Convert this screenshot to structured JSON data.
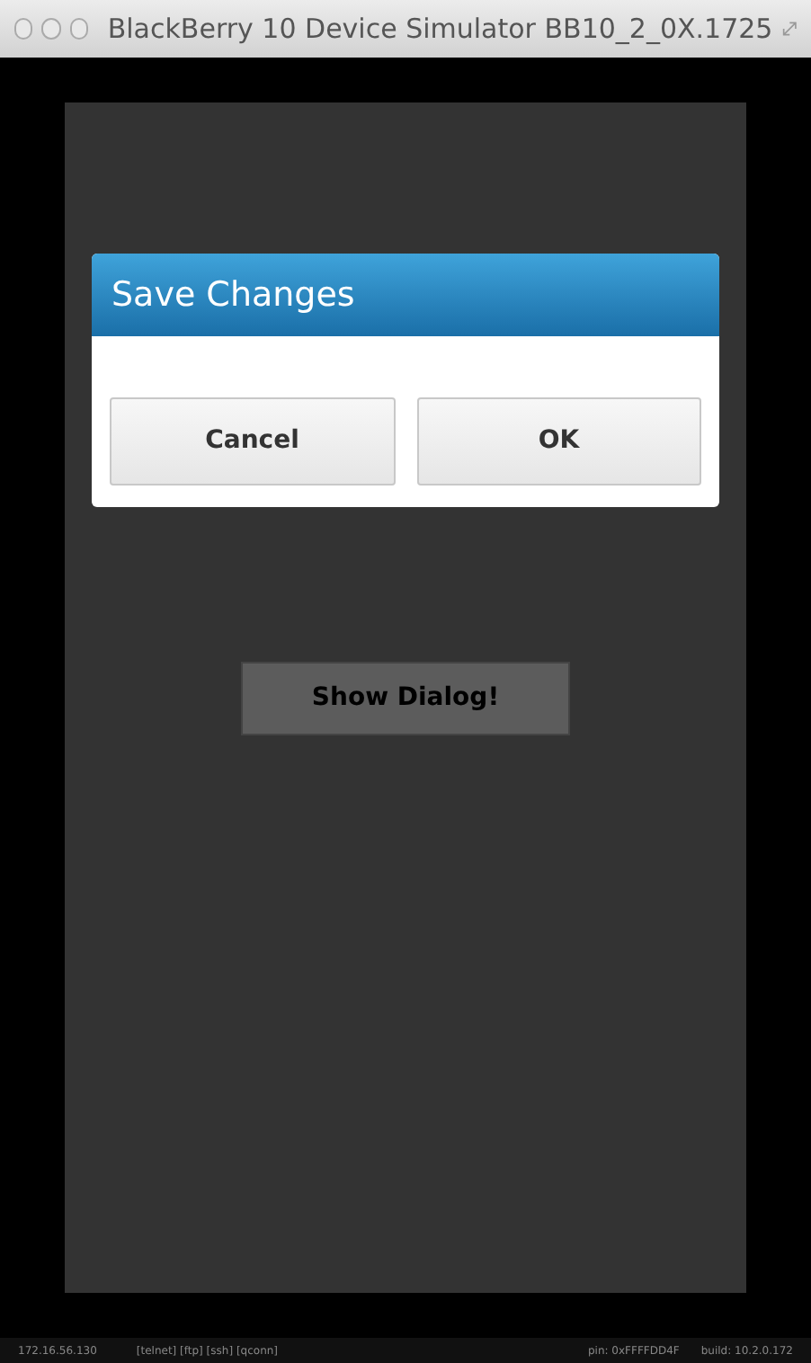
{
  "window": {
    "title": "BlackBerry 10 Device Simulator BB10_2_0X.1725"
  },
  "dialog": {
    "title": "Save Changes",
    "buttons": [
      "Cancel",
      "OK"
    ]
  },
  "screen_button": {
    "label": "Show Dialog!"
  },
  "status_bar": {
    "ip": "172.16.56.130",
    "services": "[telnet] [ftp] [ssh] [qconn]",
    "pin": "pin: 0xFFFFDD4F",
    "build": "build: 10.2.0.172"
  }
}
